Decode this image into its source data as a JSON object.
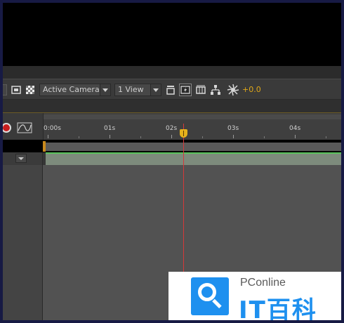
{
  "toolbar": {
    "camera_select": "Active Camera",
    "view_select": "1 View",
    "exposure_value": "+0.0"
  },
  "timeline": {
    "ruler_labels": [
      "0:00s",
      "01s",
      "02s",
      "03s",
      "04s"
    ]
  },
  "watermark": {
    "brand_small": "PConline",
    "brand_big": "IT百科"
  },
  "colors": {
    "accent": "#e6b21c",
    "playhead": "#d43a3a",
    "layer_bar": "#7d8b7c",
    "layer_bar_top": "#59c45c",
    "watermark_blue": "#1e90ef"
  },
  "icons": [
    "record-icon",
    "graph-editor-icon",
    "region-of-interest-icon",
    "transparency-grid-icon",
    "layout-icon",
    "fast-preview-icon",
    "3d-view-icon",
    "flowchart-icon",
    "exposure-icon"
  ]
}
